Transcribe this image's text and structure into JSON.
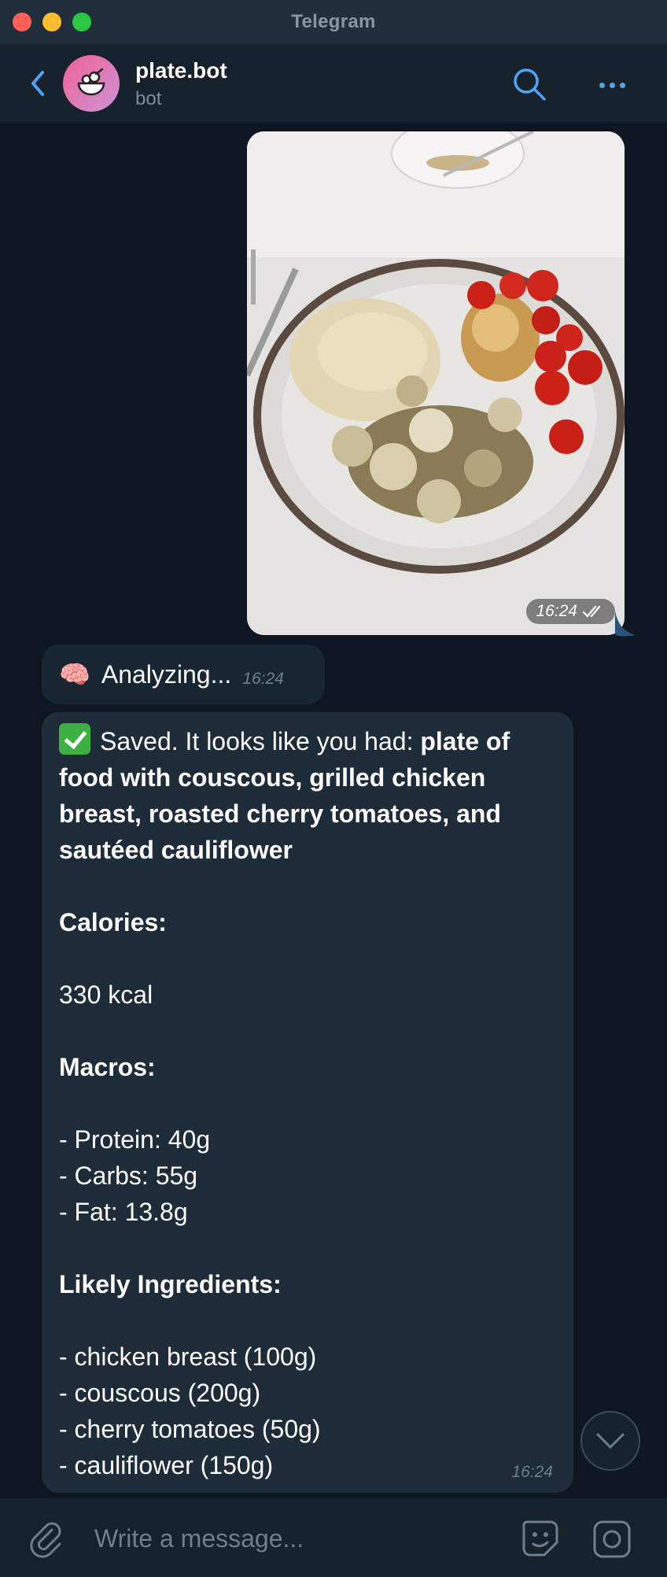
{
  "window": {
    "title": "Telegram"
  },
  "header": {
    "name": "plate.bot",
    "subtitle": "bot"
  },
  "photo": {
    "time": "16:24"
  },
  "analyzing": {
    "emoji": "🧠",
    "text": "Analyzing...",
    "time": "16:24"
  },
  "result": {
    "intro": "Saved. It looks like you had: ",
    "food_line1": "plate of",
    "food_line2": "food with couscous, grilled chicken",
    "food_line3": "breast, roasted cherry tomatoes, and",
    "food_line4": "sautéed cauliflower",
    "calories_label": "Calories:",
    "calories_value": "330 kcal",
    "macros_label": "Macros:",
    "macros": [
      "- Protein: 40g",
      "- Carbs: 55g",
      "- Fat: 13.8g"
    ],
    "ingredients_label": "Likely Ingredients:",
    "ingredients": [
      "- chicken breast (100g)",
      "- couscous (200g)",
      "- cherry tomatoes (50g)",
      "- cauliflower (150g)"
    ],
    "time": "16:24"
  },
  "composer": {
    "placeholder": "Write a message..."
  },
  "colors": {
    "accent": "#4ea4f5",
    "incoming_bubble": "#1e2c3a",
    "background": "#0e1621",
    "success": "#3cb043"
  }
}
